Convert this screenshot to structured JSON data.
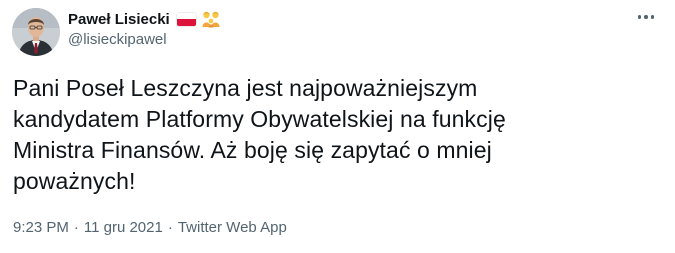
{
  "tweet": {
    "author": {
      "display_name": "Paweł Lisiecki",
      "handle": "@lisieckipawel",
      "avatar_icon": "profile-photo-man-in-suit",
      "badges": [
        "poland-flag-icon",
        "family-icon"
      ]
    },
    "more_icon": "more-horizontal-icon",
    "text_lines": [
      "Pani Poseł Leszczyna jest najpoważniejszym",
      "kandydatem Platformy Obywatelskiej na funkcję",
      "Ministra Finansów. Aż boję się zapytać o mniej",
      "poważnych!"
    ],
    "meta": {
      "time": "9:23 PM",
      "separator": "·",
      "date": "11 gru 2021",
      "separator2": "·",
      "source": "Twitter Web App"
    }
  },
  "colors": {
    "text_primary": "#0f1419",
    "text_secondary": "#536471",
    "flag_red": "#dc143c",
    "background": "#ffffff"
  }
}
